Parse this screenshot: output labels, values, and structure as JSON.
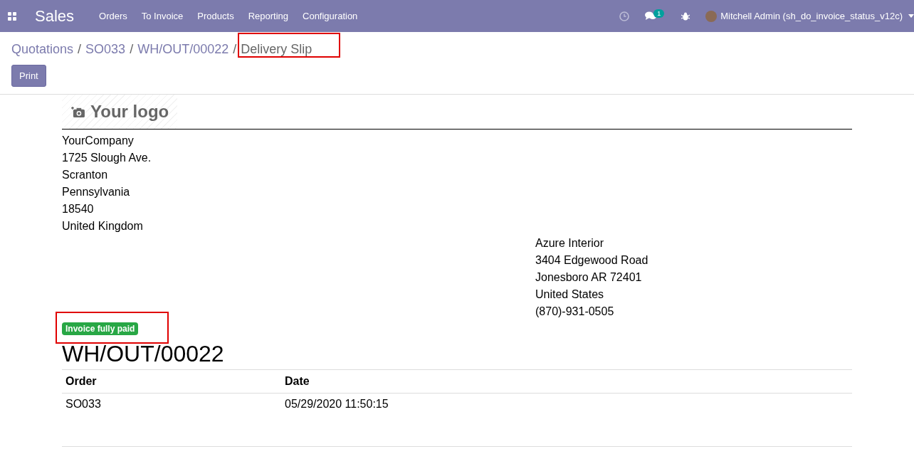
{
  "navbar": {
    "app": "Sales",
    "menu": [
      "Orders",
      "To Invoice",
      "Products",
      "Reporting",
      "Configuration"
    ],
    "chat_count": "1",
    "user": "Mitchell Admin (sh_do_invoice_status_v12c)"
  },
  "breadcrumbs": [
    {
      "label": "Quotations",
      "current": false
    },
    {
      "separator": "/",
      "label": "SO033",
      "current": false
    },
    {
      "separator": "/",
      "label": "WH/OUT/00022",
      "current": false
    },
    {
      "separator": "/",
      "label": "Delivery Slip",
      "current": true
    }
  ],
  "print_button": "Print",
  "report": {
    "logo": "Your logo",
    "company_address": [
      "YourCompany",
      "1725 Slough Ave.",
      "Scranton",
      "Pennsylvania",
      "18540",
      "United Kingdom"
    ],
    "customer_address": [
      "Azure Interior",
      "3404 Edgewood Road",
      "Jonesboro AR 72401",
      "United States",
      "(870)-931-0505"
    ],
    "invoice_status": "Invoice fully paid",
    "title": "WH/OUT/00022",
    "table": {
      "columns": [
        "Order",
        "Date"
      ],
      "rows": [
        [
          "SO033",
          "05/29/2020 11:50:15"
        ]
      ]
    }
  }
}
